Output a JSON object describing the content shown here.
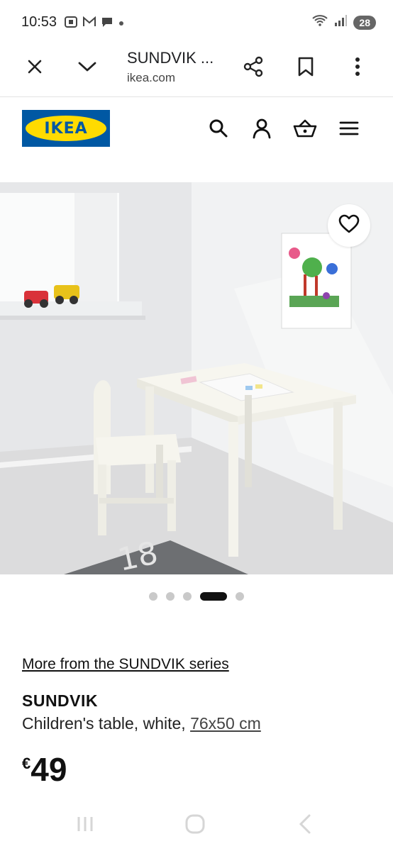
{
  "status": {
    "time": "10:53",
    "battery": "28"
  },
  "browser": {
    "page_title": "SUNDVIK ...",
    "domain": "ikea.com",
    "icons": [
      "close-icon",
      "chevron-down-icon",
      "share-icon",
      "bookmark-icon",
      "more-vert-icon"
    ]
  },
  "header": {
    "logo_text": "IKEA",
    "brand_blue": "#0058a3",
    "brand_yellow": "#ffdb00",
    "icons": [
      "search-icon",
      "user-icon",
      "basket-icon",
      "menu-icon"
    ]
  },
  "gallery": {
    "image_count": 5,
    "active_index": 3
  },
  "product": {
    "series_link": "More from the SUNDVIK series",
    "name": "SUNDVIK",
    "description": "Children's table, white, ",
    "size": "76x50 cm",
    "currency": "€",
    "price": "49"
  }
}
